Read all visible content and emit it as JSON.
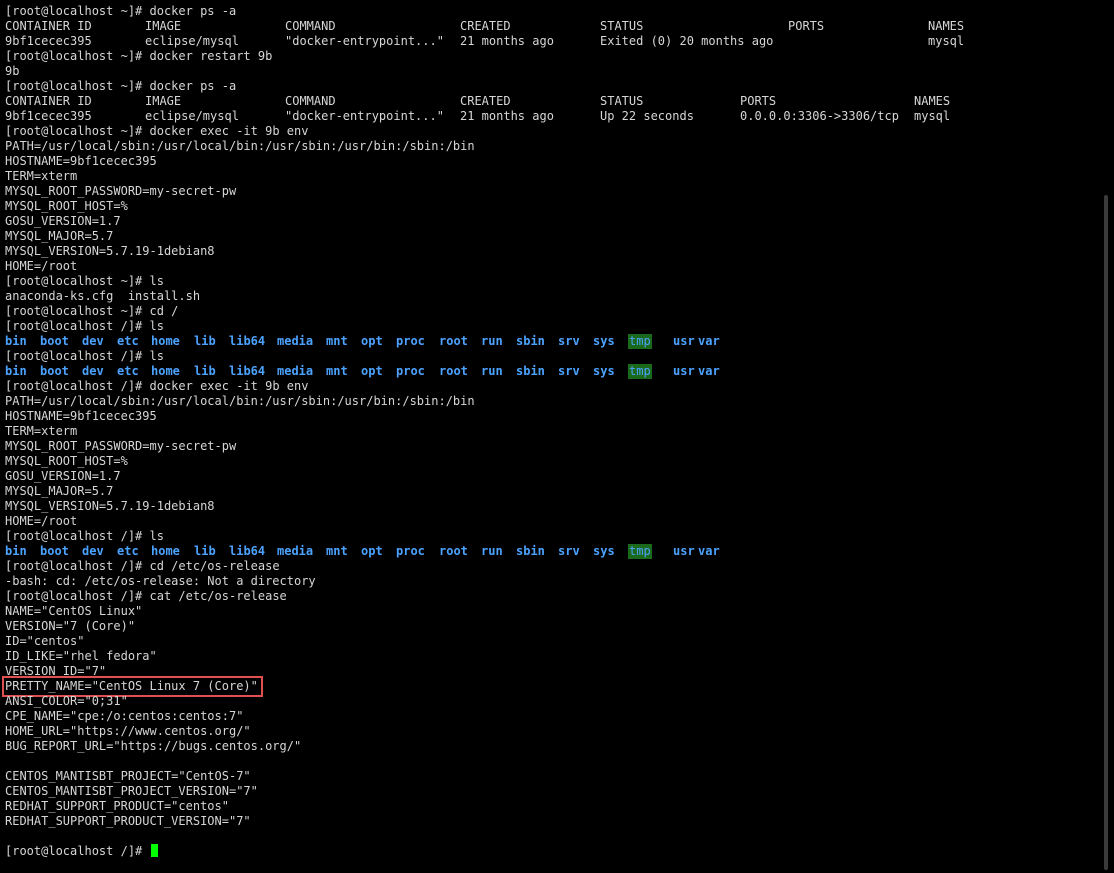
{
  "colors": {
    "background": "#000000",
    "text": "#d6d6d6",
    "directory": "#4ba3ff",
    "sticky_dir_bg": "#1b6a1b",
    "highlight_border": "#e05050",
    "cursor": "#00ff00"
  },
  "highlight": "red-rectangle-around-PRETTY_NAME",
  "prompt_tilde": "[root@localhost ~]# ",
  "prompt_root": "[root@localhost /]# ",
  "commands": {
    "ps_a": "docker ps -a",
    "restart": "docker restart 9b",
    "exec_env": "docker exec -it 9b env",
    "ls": "ls",
    "cd_root": "cd /",
    "cd_os_release": "cd /etc/os-release",
    "cat_os_release": "cat /etc/os-release"
  },
  "ps_table_1": {
    "headers": [
      "CONTAINER ID",
      "IMAGE",
      "COMMAND",
      "CREATED",
      "STATUS",
      "PORTS",
      "NAMES"
    ],
    "row": [
      "9bf1cecec395",
      "eclipse/mysql",
      "\"docker-entrypoint...\"",
      "21 months ago",
      "Exited (0) 20 months ago",
      "",
      "mysql"
    ]
  },
  "restart_output": "9b",
  "ps_table_2": {
    "headers": [
      "CONTAINER ID",
      "IMAGE",
      "COMMAND",
      "CREATED",
      "STATUS",
      "PORTS",
      "NAMES"
    ],
    "row": [
      "9bf1cecec395",
      "eclipse/mysql",
      "\"docker-entrypoint...\"",
      "21 months ago",
      "Up 22 seconds",
      "0.0.0.0:3306->3306/tcp",
      "mysql"
    ]
  },
  "env_output": [
    "PATH=/usr/local/sbin:/usr/local/bin:/usr/sbin:/usr/bin:/sbin:/bin",
    "HOSTNAME=9bf1cecec395",
    "TERM=xterm",
    "MYSQL_ROOT_PASSWORD=my-secret-pw",
    "MYSQL_ROOT_HOST=%",
    "GOSU_VERSION=1.7",
    "MYSQL_MAJOR=5.7",
    "MYSQL_VERSION=5.7.19-1debian8",
    "HOME=/root"
  ],
  "ls_home_output": "anaconda-ks.cfg  install.sh",
  "root_dirs": [
    "bin",
    "boot",
    "dev",
    "etc",
    "home",
    "lib",
    "lib64",
    "media",
    "mnt",
    "opt",
    "proc",
    "root",
    "run",
    "sbin",
    "srv",
    "sys",
    "tmp",
    "usr",
    "var"
  ],
  "cd_error": "-bash: cd: /etc/os-release: Not a directory",
  "os_release_before": [
    "NAME=\"CentOS Linux\"",
    "VERSION=\"7 (Core)\"",
    "ID=\"centos\"",
    "ID_LIKE=\"rhel fedora\"",
    "VERSION_ID=\"7\""
  ],
  "pretty_name": "PRETTY_NAME=\"CentOS Linux 7 (Core)\"",
  "os_release_after": [
    "ANSI_COLOR=\"0;31\"",
    "CPE_NAME=\"cpe:/o:centos:centos:7\"",
    "HOME_URL=\"https://www.centos.org/\"",
    "BUG_REPORT_URL=\"https://bugs.centos.org/\"",
    "",
    "CENTOS_MANTISBT_PROJECT=\"CentOS-7\"",
    "CENTOS_MANTISBT_PROJECT_VERSION=\"7\"",
    "REDHAT_SUPPORT_PRODUCT=\"centos\"",
    "REDHAT_SUPPORT_PRODUCT_VERSION=\"7\"",
    ""
  ]
}
